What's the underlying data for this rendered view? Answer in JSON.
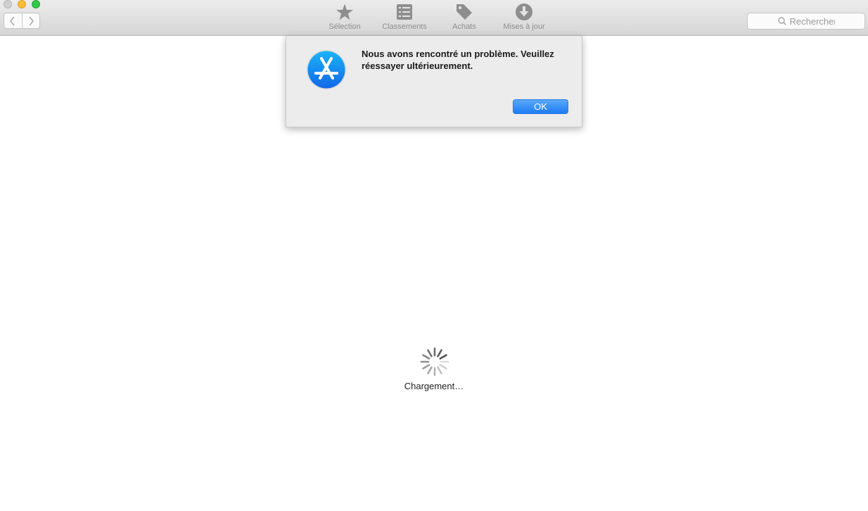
{
  "toolbar": {
    "tabs": [
      {
        "label": "Sélection",
        "icon": "star-icon"
      },
      {
        "label": "Classements",
        "icon": "list-icon"
      },
      {
        "label": "Achats",
        "icon": "tag-icon"
      },
      {
        "label": "Mises à jour",
        "icon": "download-icon"
      }
    ],
    "search": {
      "placeholder": "Rechercher"
    }
  },
  "dialog": {
    "message": "Nous avons rencontré un problème. Veuillez réessayer ultérieurement.",
    "ok_label": "OK",
    "icon": "app-store-icon"
  },
  "content": {
    "loading_label": "Chargement…"
  },
  "colors": {
    "accent": "#1c7cf1",
    "toolbar_icon": "#8e8e8e"
  }
}
